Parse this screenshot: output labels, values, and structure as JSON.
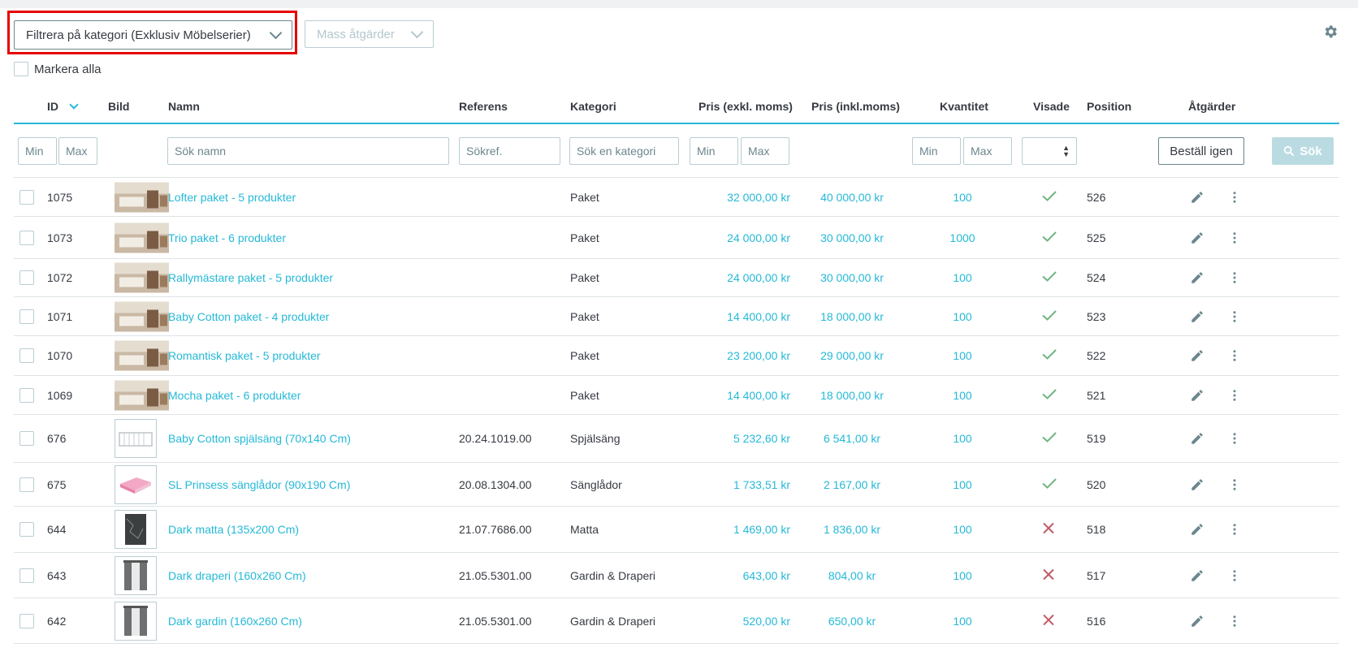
{
  "toolbar": {
    "filter_category_label": "Filtrera på kategori (Exklusiv Möbelserier)",
    "mass_actions_label": "Mass åtgärder",
    "select_all_label": "Markera alla"
  },
  "columns": {
    "id": "ID",
    "image": "Bild",
    "name": "Namn",
    "reference": "Referens",
    "category": "Kategori",
    "price_excl": "Pris (exkl. moms)",
    "price_incl": "Pris (inkl.moms)",
    "quantity": "Kvantitet",
    "shown": "Visade",
    "position": "Position",
    "actions": "Åtgärder"
  },
  "filters": {
    "id_min": "Min",
    "id_max": "Max",
    "name": "Sök namn",
    "reference": "Sökref.",
    "category": "Sök en kategori",
    "price_min": "Min",
    "price_max": "Max",
    "qty_min": "Min",
    "qty_max": "Max",
    "reset_label": "Beställ igen",
    "search_label": "Sök"
  },
  "colors": {
    "accent": "#25b9d7",
    "check": "#70b580",
    "cross": "#c05c67",
    "highlight_border": "#e60000"
  },
  "rows": [
    {
      "id": "1075",
      "name": "Lofter paket - 5 produkter",
      "reference": "",
      "category": "Paket",
      "price_excl": "32 000,00 kr",
      "price_incl": "40 000,00 kr",
      "quantity": "100",
      "shown": true,
      "position": "526",
      "thumb": "room"
    },
    {
      "id": "1073",
      "name": "Trio paket - 6 produkter",
      "reference": "",
      "category": "Paket",
      "price_excl": "24 000,00 kr",
      "price_incl": "30 000,00 kr",
      "quantity": "1000",
      "shown": true,
      "position": "525",
      "thumb": "room"
    },
    {
      "id": "1072",
      "name": "Rallymästare paket - 5 produkter",
      "reference": "",
      "category": "Paket",
      "price_excl": "24 000,00 kr",
      "price_incl": "30 000,00 kr",
      "quantity": "100",
      "shown": true,
      "position": "524",
      "thumb": "room"
    },
    {
      "id": "1071",
      "name": "Baby Cotton paket - 4 produkter",
      "reference": "",
      "category": "Paket",
      "price_excl": "14 400,00 kr",
      "price_incl": "18 000,00 kr",
      "quantity": "100",
      "shown": true,
      "position": "523",
      "thumb": "room"
    },
    {
      "id": "1070",
      "name": "Romantisk paket - 5 produkter",
      "reference": "",
      "category": "Paket",
      "price_excl": "23 200,00 kr",
      "price_incl": "29 000,00 kr",
      "quantity": "100",
      "shown": true,
      "position": "522",
      "thumb": "room"
    },
    {
      "id": "1069",
      "name": "Mocha paket - 6 produkter",
      "reference": "",
      "category": "Paket",
      "price_excl": "14 400,00 kr",
      "price_incl": "18 000,00 kr",
      "quantity": "100",
      "shown": true,
      "position": "521",
      "thumb": "room"
    },
    {
      "id": "676",
      "name": "Baby Cotton spjälsäng (70x140 Cm)",
      "reference": "20.24.1019.00",
      "category": "Spjälsäng",
      "price_excl": "5 232,60 kr",
      "price_incl": "6 541,00 kr",
      "quantity": "100",
      "shown": true,
      "position": "519",
      "thumb": "crib"
    },
    {
      "id": "675",
      "name": "SL Prinsess sänglådor (90x190 Cm)",
      "reference": "20.08.1304.00",
      "category": "Sänglådor",
      "price_excl": "1 733,51 kr",
      "price_incl": "2 167,00 kr",
      "quantity": "100",
      "shown": true,
      "position": "520",
      "thumb": "mattress"
    },
    {
      "id": "644",
      "name": "Dark matta (135x200 Cm)",
      "reference": "21.07.7686.00",
      "category": "Matta",
      "price_excl": "1 469,00 kr",
      "price_incl": "1 836,00 kr",
      "quantity": "100",
      "shown": false,
      "position": "518",
      "thumb": "rug"
    },
    {
      "id": "643",
      "name": "Dark draperi (160x260 Cm)",
      "reference": "21.05.5301.00",
      "category": "Gardin & Draperi",
      "price_excl": "643,00 kr",
      "price_incl": "804,00 kr",
      "quantity": "100",
      "shown": false,
      "position": "517",
      "thumb": "curtain"
    },
    {
      "id": "642",
      "name": "Dark gardin (160x260 Cm)",
      "reference": "21.05.5301.00",
      "category": "Gardin & Draperi",
      "price_excl": "520,00 kr",
      "price_incl": "650,00 kr",
      "quantity": "100",
      "shown": false,
      "position": "516",
      "thumb": "curtain"
    }
  ]
}
